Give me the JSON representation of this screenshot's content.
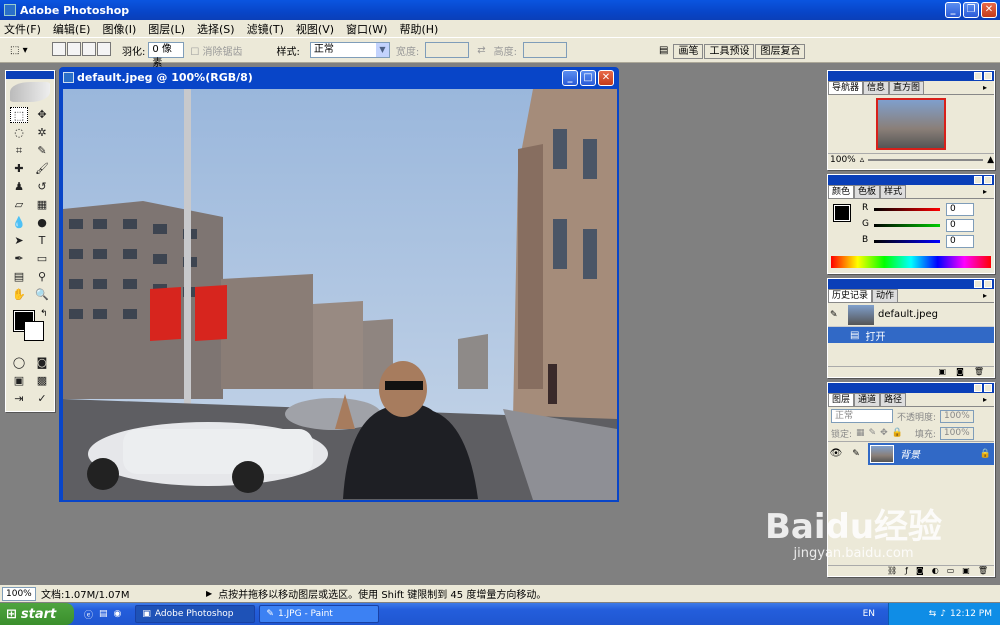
{
  "app": {
    "title": "Adobe Photoshop"
  },
  "menu": [
    "文件(F)",
    "编辑(E)",
    "图像(I)",
    "图层(L)",
    "选择(S)",
    "滤镜(T)",
    "视图(V)",
    "窗口(W)",
    "帮助(H)"
  ],
  "options": {
    "feather_label": "羽化:",
    "feather_value": "0 像素",
    "antialias_label": "消除锯齿",
    "style_label": "样式:",
    "style_value": "正常",
    "width_label": "宽度:",
    "height_label": "高度:"
  },
  "palette_well": [
    "画笔",
    "工具预设",
    "图层复合"
  ],
  "document": {
    "title": "default.jpeg @ 100%(RGB/8)"
  },
  "navigator": {
    "tabs": [
      "导航器",
      "信息",
      "直方图"
    ],
    "zoom": "100%"
  },
  "color_panel": {
    "tabs": [
      "颜色",
      "色板",
      "样式"
    ],
    "r_label": "R",
    "g_label": "G",
    "b_label": "B",
    "r": "0",
    "g": "0",
    "b": "0"
  },
  "history": {
    "tabs": [
      "历史记录",
      "动作"
    ],
    "snapshot": "default.jpeg",
    "step": "打开"
  },
  "layers": {
    "tabs": [
      "图层",
      "通道",
      "路径"
    ],
    "blend": "正常",
    "opacity_label": "不透明度:",
    "opacity": "100%",
    "lock_label": "锁定:",
    "fill_label": "填充:",
    "fill": "100%",
    "layer_name": "背景"
  },
  "status": {
    "zoom": "100%",
    "doc": "文档:1.07M/1.07M",
    "hint": "点按并拖移以移动图层或选区。使用 Shift 键限制到 45 度增量方向移动。"
  },
  "taskbar": {
    "start": "start",
    "tasks": [
      "Adobe Photoshop",
      "1.JPG - Paint"
    ],
    "lang": "EN",
    "time": "12:12 PM"
  },
  "watermark": {
    "brand": "Baidu经验",
    "url": "jingyan.baidu.com"
  },
  "colors": {
    "titlebar": "#0845c8",
    "chrome": "#ece9d8",
    "workspace": "#808080",
    "selected": "#3169c6"
  }
}
